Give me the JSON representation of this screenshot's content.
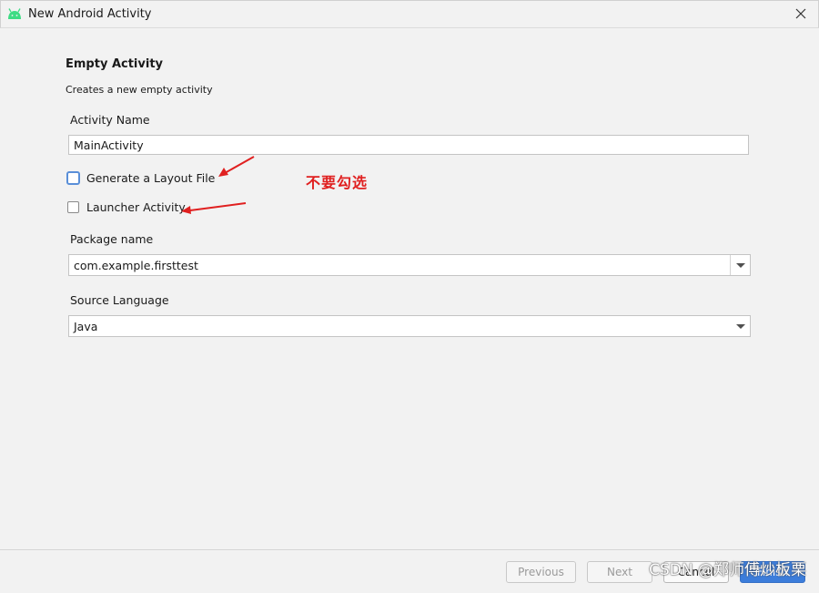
{
  "window": {
    "title": "New Android Activity",
    "close_icon": "close-icon",
    "app_icon": "android-icon"
  },
  "main": {
    "heading": "Empty Activity",
    "subheading": "Creates a new empty activity",
    "activity_name": {
      "label": "Activity Name",
      "value": "MainActivity"
    },
    "generate_layout": {
      "label": "Generate a Layout File",
      "checked": false
    },
    "launcher_activity": {
      "label": "Launcher Activity",
      "checked": false
    },
    "package_name": {
      "label": "Package name",
      "value": "com.example.firsttest"
    },
    "source_language": {
      "label": "Source Language",
      "value": "Java"
    }
  },
  "annotation": {
    "text": "不要勾选",
    "color": "#e02020"
  },
  "footer": {
    "previous_label": "Previous",
    "next_label": "Next",
    "cancel_label": "Cancel",
    "finish_label": "Finish"
  },
  "watermark": "CSDN @郑师傅炒板栗",
  "colors": {
    "accent": "#3c7ddb",
    "android_green": "#3ddc84",
    "focus": "#5a8fd8"
  }
}
